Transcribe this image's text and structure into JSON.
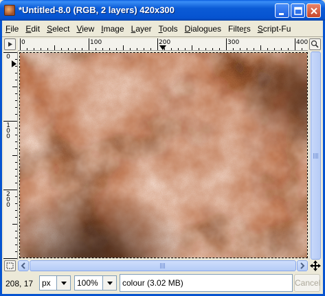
{
  "window": {
    "title": "*Untitled-8.0 (RGB, 2 layers) 420x300",
    "controls": [
      "minimize",
      "maximize",
      "close"
    ]
  },
  "menu": {
    "items": [
      {
        "label": "File",
        "underline": "F",
        "rest": "ile"
      },
      {
        "label": "Edit",
        "underline": "E",
        "rest": "dit"
      },
      {
        "label": "Select",
        "underline": "S",
        "rest": "elect"
      },
      {
        "label": "View",
        "underline": "V",
        "rest": "iew"
      },
      {
        "label": "Image",
        "underline": "I",
        "rest": "mage"
      },
      {
        "label": "Layer",
        "underline": "L",
        "rest": "ayer"
      },
      {
        "label": "Tools",
        "underline": "T",
        "rest": "ools"
      },
      {
        "label": "Dialogues",
        "underline": "D",
        "rest": "ialogues"
      },
      {
        "label": "Filters",
        "underline": "r",
        "rest": "Filte|s"
      },
      {
        "label": "Script-Fu",
        "underline": "S",
        "rest": "cript-Fu"
      }
    ]
  },
  "rulers": {
    "horizontal_labels": [
      "0",
      "100",
      "200",
      "300",
      "400"
    ],
    "vertical_labels": [
      "0",
      "100",
      "200"
    ]
  },
  "status": {
    "pointer_coords": "208, 17",
    "unit": "px",
    "zoom": "100%",
    "message": "colour (3.02 MB)",
    "cancel_label": "Cancel"
  },
  "colors": {
    "titlebar": "#0653d0",
    "canvas_base": "#b5673f"
  },
  "icons": {
    "app": "gimp-image-icon",
    "quick_mask": "quick-mask-icon",
    "navigate": "navigate-icon",
    "menu_corner": "image-menu-icon",
    "zoom": "zoom-icon"
  }
}
